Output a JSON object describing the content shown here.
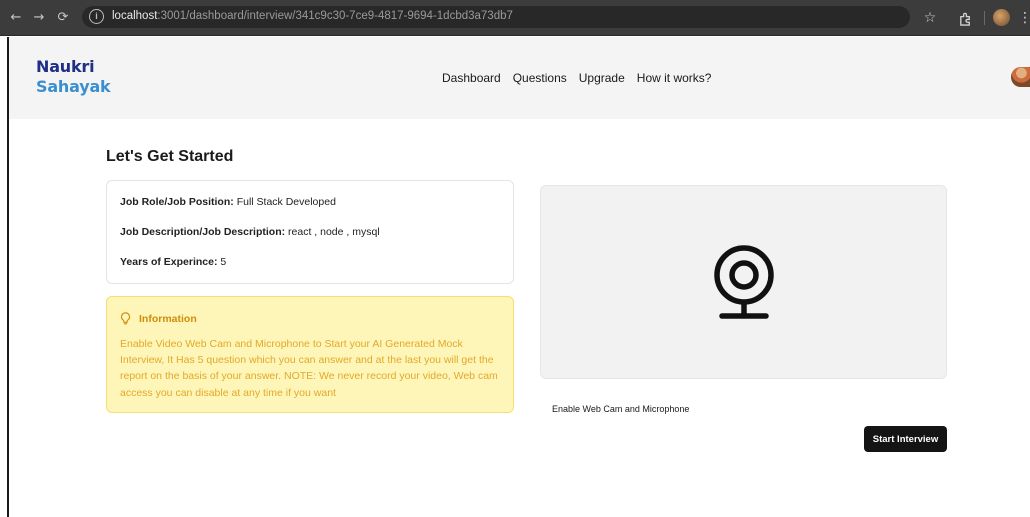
{
  "browser": {
    "url_host": "localhost",
    "url_path": ":3001/dashboard/interview/341c9c30-7ce9-4817-9694-1dcbd3a73db7",
    "icons": [
      "back-icon",
      "forward-icon",
      "reload-icon",
      "site-info-icon",
      "star-icon",
      "extensions-icon",
      "profile-icon",
      "menu-icon"
    ]
  },
  "header": {
    "logo_line1": "Naukri",
    "logo_line2": "Sahayak",
    "nav": [
      "Dashboard",
      "Questions",
      "Upgrade",
      "How it works?"
    ]
  },
  "main": {
    "title": "Let's Get Started",
    "job": {
      "role_label": "Job Role/Job Position:",
      "role_value": "Full Stack Developed",
      "desc_label": "Job Description/Job Description:",
      "desc_value": "react , node , mysql",
      "exp_label": "Years of Experince:",
      "exp_value": "5"
    },
    "info": {
      "title": "Information",
      "body": "Enable Video Web Cam and Microphone to Start your AI Generated Mock Interview, It Has 5 question which you can answer and at the last you will get the report on the basis of your answer. NOTE: We never record your video, Web cam access you can disable at any time if you want"
    },
    "webcam": {
      "enable_label": "Enable Web Cam and Microphone"
    },
    "start_button": "Start Interview"
  },
  "colors": {
    "logo_dark": "#1f2f86",
    "logo_light": "#3b8fd0",
    "info_bg": "#fef6b9",
    "info_text": "#e3a82a",
    "info_title": "#d18c0c",
    "button_bg": "#141414"
  }
}
